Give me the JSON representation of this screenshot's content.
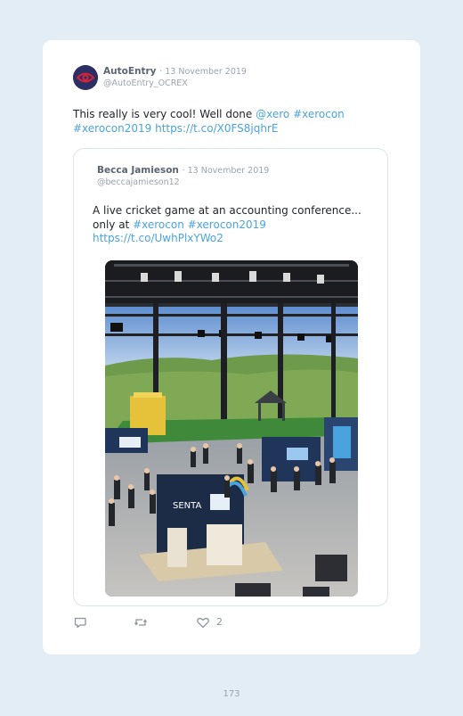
{
  "tweet": {
    "author_name": "AutoEntry",
    "date": "· 13 November 2019",
    "handle": "@AutoEntry_OCREX",
    "text_plain": "This really is very cool! Well done ",
    "text_mention": "@xero",
    "text_hashtag1": "#xerocon",
    "text_hashtag2": "#xerocon2019",
    "text_link": "https://t.co/X0FS8jqhrE",
    "like_count": "2"
  },
  "quoted_tweet": {
    "author_name": "Becca Jamieson",
    "date": "· 13 November 2019",
    "handle": "@beccajamieson12",
    "text_line1": "A live cricket game at an accounting conference...",
    "text_only_at": "only at ",
    "text_hashtag1": "#xerocon",
    "text_hashtag2": "#xerocon2019",
    "text_link": "https://t.co/UwhPlxYWo2"
  },
  "booth_sign": "SENTA",
  "page_number": "173",
  "colors": {
    "background": "#e3edf6",
    "card": "#ffffff",
    "link": "#4aa3df",
    "avatar": "#2c2f63",
    "avatar_eye": "#d4243a"
  },
  "icons": {
    "reply": "reply-icon",
    "retweet": "retweet-icon",
    "like": "heart-icon",
    "avatar": "eye-logo-icon"
  }
}
